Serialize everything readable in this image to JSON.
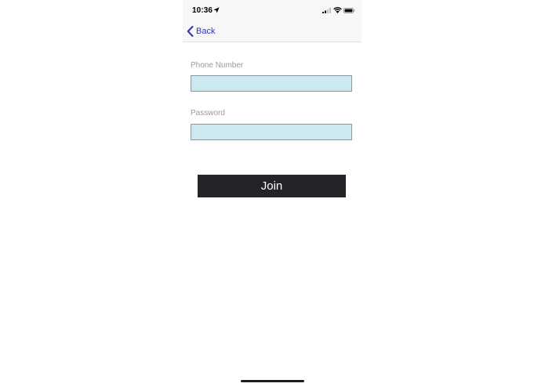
{
  "status_bar": {
    "time": "10:36",
    "icons": [
      "location-arrow-icon",
      "cellular-signal-icon",
      "wifi-icon",
      "battery-icon"
    ]
  },
  "nav": {
    "back_label": "Back",
    "back_icon": "chevron-left-icon"
  },
  "form": {
    "phone_label": "Phone Number",
    "phone_value": "",
    "password_label": "Password",
    "password_value": "",
    "join_label": "Join"
  },
  "colors": {
    "accent": "#2f3aa8",
    "input_background": "#cde9f0",
    "button_background": "#232428",
    "label_text": "#9a9a9a"
  }
}
